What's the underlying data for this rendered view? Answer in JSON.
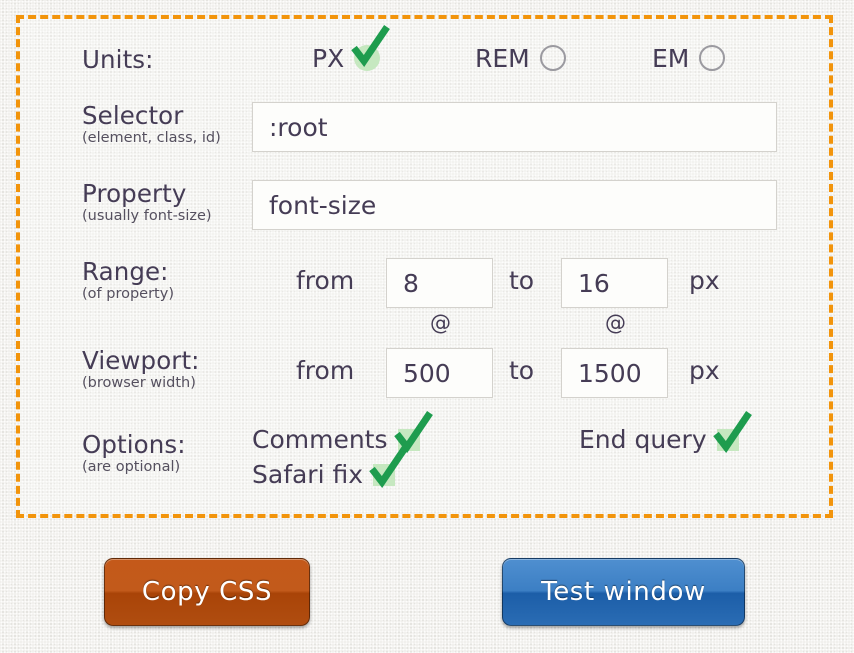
{
  "theme": {
    "accent_border": "#f2940b",
    "text": "#453c55",
    "check_green": "#1e9c4e",
    "check_box_fill": "#c6e8c0",
    "copy_button": "#b8500f",
    "test_button": "#2f72b8"
  },
  "form": {
    "units": {
      "label": "Units:",
      "options": [
        {
          "label": "PX",
          "selected": true,
          "icon": "check-icon"
        },
        {
          "label": "REM",
          "selected": false,
          "icon": "radio-empty-icon"
        },
        {
          "label": "EM",
          "selected": false,
          "icon": "radio-empty-icon"
        }
      ]
    },
    "selector": {
      "label": "Selector",
      "sublabel": "(element, class, id)",
      "value": ":root",
      "placeholder": ":root"
    },
    "property": {
      "label": "Property",
      "sublabel": "(usually font-size)",
      "value": "font-size",
      "placeholder": "font-size"
    },
    "range": {
      "label": "Range:",
      "sublabel": "(of property)",
      "from_word": "from",
      "to_word": "to",
      "from_value": "8",
      "to_value": "16",
      "unit": "px",
      "at_symbol_from": "@",
      "at_symbol_to": "@"
    },
    "viewport": {
      "label": "Viewport:",
      "sublabel": "(browser width)",
      "from_word": "from",
      "to_word": "to",
      "from_value": "500",
      "to_value": "1500",
      "unit": "px"
    },
    "options": {
      "label": "Options:",
      "sublabel": "(are optional)",
      "items": [
        {
          "label": "Comments",
          "checked": true
        },
        {
          "label": "Safari fix",
          "checked": true
        },
        {
          "label": "End query",
          "checked": true
        }
      ]
    }
  },
  "actions": {
    "copy_css": "Copy CSS",
    "test_window": "Test window"
  }
}
